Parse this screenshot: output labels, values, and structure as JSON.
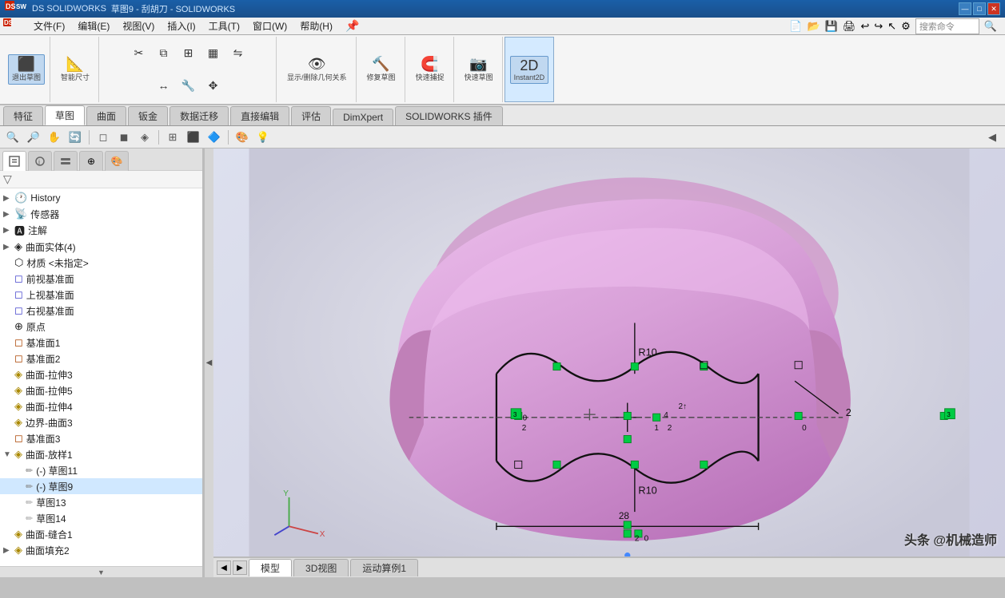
{
  "titlebar": {
    "logo": "DS SOLIDWORKS",
    "title": "草图9 - 刮胡刀 - SOLIDWORKS",
    "search_placeholder": "搜索命令",
    "min_label": "—",
    "max_label": "□",
    "close_label": "✕"
  },
  "menubar": {
    "items": [
      "文件(F)",
      "编辑(E)",
      "视图(V)",
      "插入(I)",
      "工具(T)",
      "窗口(W)",
      "帮助(H)"
    ]
  },
  "toolbar": {
    "exit_sketch_label": "退出草图",
    "smart_dim_label": "智能尺寸",
    "instant2d_label": "Instant2D",
    "trim_label": "剪裁实体",
    "convert_label": "转换实体引用",
    "offset_label": "等距实体",
    "linear_pattern_label": "线性草图阵列",
    "show_hide_label": "显示/删除几何关系",
    "fix_sketch_label": "修复草图",
    "quick_snap_label": "快速捕捉",
    "quick_view_label": "快速草图"
  },
  "tabs": {
    "items": [
      "特征",
      "草图",
      "曲面",
      "钣金",
      "数据迁移",
      "直接编辑",
      "评估",
      "DimXpert",
      "SOLIDWORKS 插件"
    ]
  },
  "tree": {
    "items": [
      {
        "label": "History",
        "icon": "🕐",
        "indent": 0,
        "expander": "▶"
      },
      {
        "label": "传感器",
        "icon": "📡",
        "indent": 0,
        "expander": "▶"
      },
      {
        "label": "注解",
        "icon": "🅰",
        "indent": 0,
        "expander": "▶"
      },
      {
        "label": "曲面实体(4)",
        "icon": "◈",
        "indent": 0,
        "expander": "▶"
      },
      {
        "label": "材质 <未指定>",
        "icon": "⬡",
        "indent": 0,
        "expander": ""
      },
      {
        "label": "前视基准面",
        "icon": "◻",
        "indent": 0,
        "expander": ""
      },
      {
        "label": "上视基准面",
        "icon": "◻",
        "indent": 0,
        "expander": ""
      },
      {
        "label": "右视基准面",
        "icon": "◻",
        "indent": 0,
        "expander": ""
      },
      {
        "label": "原点",
        "icon": "⊕",
        "indent": 0,
        "expander": ""
      },
      {
        "label": "基准面1",
        "icon": "◻",
        "indent": 0,
        "expander": ""
      },
      {
        "label": "基准面2",
        "icon": "◻",
        "indent": 0,
        "expander": ""
      },
      {
        "label": "曲面-拉伸3",
        "icon": "◈",
        "indent": 0,
        "expander": ""
      },
      {
        "label": "曲面-拉伸5",
        "icon": "◈",
        "indent": 0,
        "expander": ""
      },
      {
        "label": "曲面-拉伸4",
        "icon": "◈",
        "indent": 0,
        "expander": ""
      },
      {
        "label": "边界-曲面3",
        "icon": "◈",
        "indent": 0,
        "expander": ""
      },
      {
        "label": "基准面3",
        "icon": "◻",
        "indent": 0,
        "expander": ""
      },
      {
        "label": "曲面-放样1",
        "icon": "◈",
        "indent": 0,
        "expander": "▼"
      },
      {
        "label": "(-) 草图11",
        "icon": "✏",
        "indent": 1,
        "expander": ""
      },
      {
        "label": "(-) 草图9",
        "icon": "✏",
        "indent": 1,
        "expander": ""
      },
      {
        "label": "草图13",
        "icon": "✏",
        "indent": 1,
        "expander": ""
      },
      {
        "label": "草图14",
        "icon": "✏",
        "indent": 1,
        "expander": ""
      },
      {
        "label": "曲面-缝合1",
        "icon": "◈",
        "indent": 0,
        "expander": ""
      },
      {
        "label": "曲面填充2",
        "icon": "◈",
        "indent": 0,
        "expander": "▶"
      }
    ]
  },
  "bottom_tabs": {
    "items": [
      "模型",
      "3D视图",
      "运动算例1"
    ]
  },
  "viewport": {
    "coord_label": "Y",
    "watermark": "头条 @机械造师"
  },
  "colors": {
    "shape_fill": "#e8b8e8",
    "shape_fill2": "#d090c8",
    "bg_gradient_start": "#e8e8f0",
    "bg_gradient_end": "#d5d5e8",
    "accent_blue": "#1a5fa8",
    "green_node": "#00cc44",
    "line_dark": "#111111"
  }
}
